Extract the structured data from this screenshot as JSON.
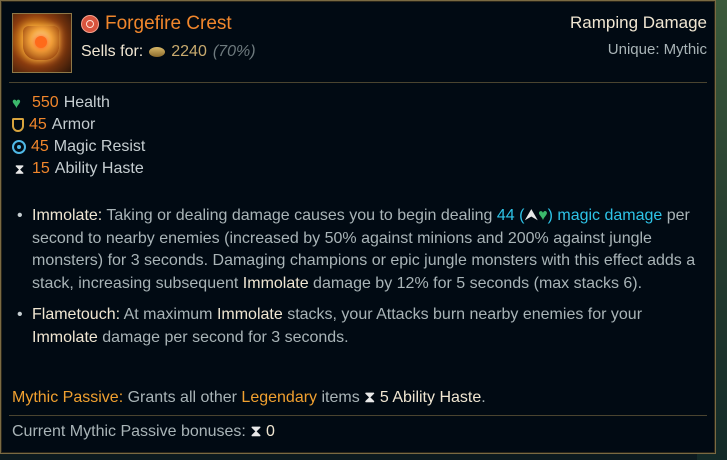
{
  "item": {
    "name": "Forgefire Crest",
    "sells_label": "Sells for:",
    "sell_gold": "2240",
    "sell_pct": "(70%)",
    "tag_primary": "Ramping Damage",
    "tag_secondary": "Unique: Mythic",
    "icon": "forgefire-crest-icon"
  },
  "stats": [
    {
      "value": "550",
      "label": "Health",
      "icon": "health-icon"
    },
    {
      "value": "45",
      "label": "Armor",
      "icon": "armor-icon"
    },
    {
      "value": "45",
      "label": "Magic Resist",
      "icon": "magic-resist-icon"
    },
    {
      "value": "15",
      "label": "Ability Haste",
      "icon": "ability-haste-icon"
    }
  ],
  "passives": {
    "immolate": {
      "name": "Immolate:",
      "t1": " Taking or dealing damage causes you to begin dealing ",
      "dmg_value": "44",
      "dmg_open": " (",
      "dmg_close": ")",
      "dmg_type": " magic damage",
      "t2": " per second to nearby enemies (increased by 50% against minions and 200% against jungle monsters) for 3 seconds. Damaging champions or epic jungle monsters with this effect adds a stack, increasing subsequent ",
      "kw": "Immolate",
      "t3": " damage by 12% for 5 seconds (max stacks 6)."
    },
    "flametouch": {
      "name": "Flametouch:",
      "t1": " At maximum ",
      "kw1": "Immolate",
      "t2": " stacks, your Attacks burn nearby enemies for your ",
      "kw2": "Immolate",
      "t3": " damage per second for 3 seconds."
    }
  },
  "mythic": {
    "label": "Mythic Passive:",
    "t1": " Grants all other ",
    "legendary": "Legendary",
    "t2": " items ",
    "bonus": "5 Ability Haste",
    "t3": "."
  },
  "current": {
    "label": "Current Mythic Passive bonuses:",
    "value": "0"
  },
  "colors": {
    "accent_orange": "#f0862c",
    "magic_blue": "#2ec4e8",
    "mythic_gold": "#f0a030",
    "border_gold": "#7a6a43"
  }
}
